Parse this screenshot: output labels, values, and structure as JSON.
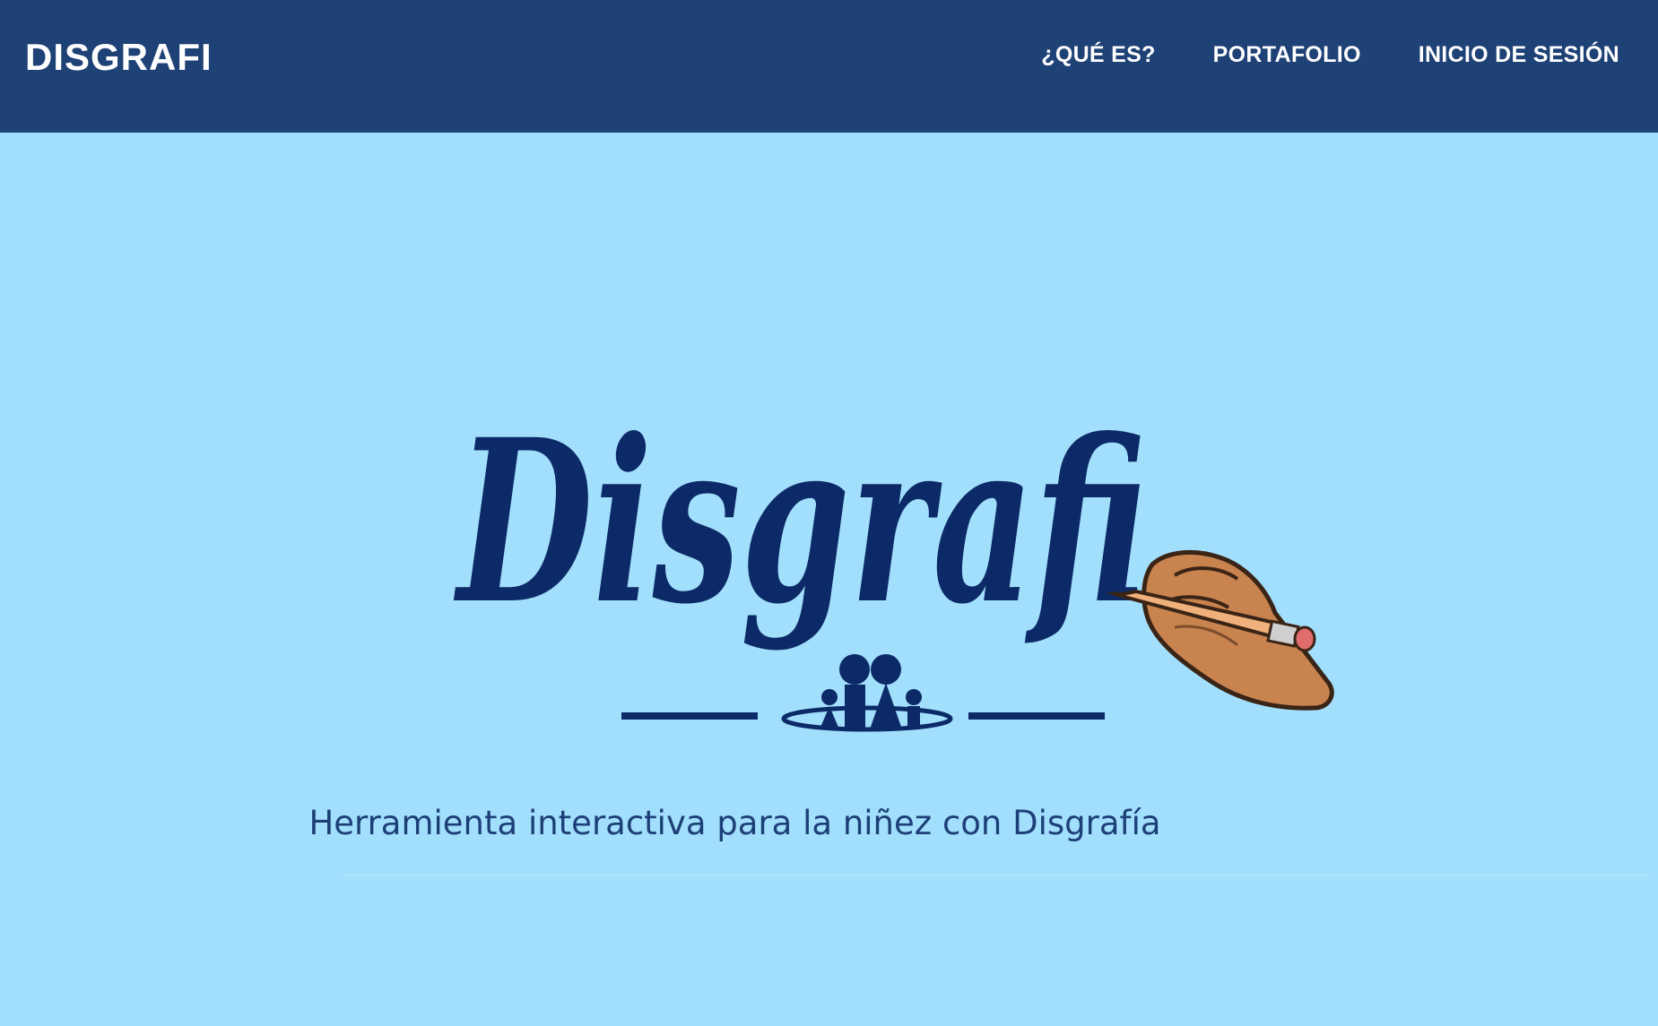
{
  "brand": {
    "name": "DISGRAFI"
  },
  "nav": {
    "items": [
      {
        "label": "¿QUÉ ES?"
      },
      {
        "label": "PORTAFOLIO"
      },
      {
        "label": "INICIO DE SESIÓN"
      }
    ]
  },
  "hero": {
    "logo_text": "Disgrafi",
    "tagline": "Herramienta interactiva para la niñez con Disgrafía"
  },
  "colors": {
    "navbar": "#1e4176",
    "hero_background": "#a2dffc",
    "logo_ink": "#0c2a67",
    "tagline": "#1d3f78"
  },
  "icons": [
    "family-icon",
    "hand-pencil-icon"
  ]
}
